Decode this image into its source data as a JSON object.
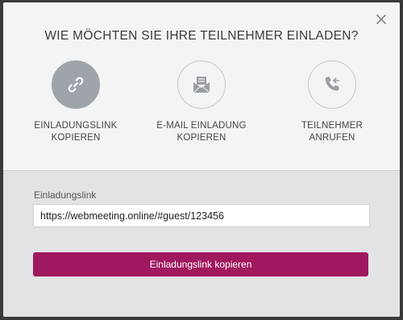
{
  "dialog": {
    "title": "WIE MÖCHTEN SIE IHRE TEILNEHMER EINLADEN?",
    "close_icon": "close-icon"
  },
  "options": [
    {
      "line1": "EINLADUNGSLINK",
      "line2": "KOPIEREN",
      "icon": "link-icon",
      "active": true
    },
    {
      "line1": "E-MAIL EINLADUNG",
      "line2": "KOPIEREN",
      "icon": "envelope-icon",
      "active": false
    },
    {
      "line1": "TEILNEHMER",
      "line2": "ANRUFEN",
      "icon": "phone-icon",
      "active": false
    }
  ],
  "invite": {
    "label": "Einladungslink",
    "value": "https://webmeeting.online/#guest/123456",
    "button_label": "Einladungslink kopieren"
  },
  "colors": {
    "accent": "#a0195f",
    "active_circle": "#9fa4aa",
    "icon_gray": "#9a9ea4"
  }
}
